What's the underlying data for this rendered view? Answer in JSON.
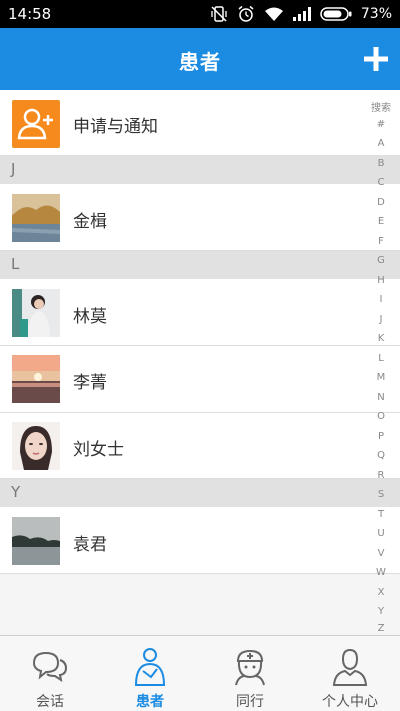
{
  "status_bar": {
    "time": "14:58",
    "battery": "73%"
  },
  "app_bar": {
    "title": "患者"
  },
  "notify_row": {
    "label": "申请与通知"
  },
  "sections": [
    {
      "letter": "J",
      "patients": [
        {
          "name": "金楫"
        }
      ]
    },
    {
      "letter": "L",
      "patients": [
        {
          "name": "林莫"
        },
        {
          "name": "李菁"
        },
        {
          "name": "刘女士"
        }
      ]
    },
    {
      "letter": "Y",
      "patients": [
        {
          "name": "袁君"
        }
      ]
    }
  ],
  "index_bar": [
    "搜索",
    "#",
    "A",
    "B",
    "C",
    "D",
    "E",
    "F",
    "G",
    "H",
    "I",
    "J",
    "K",
    "L",
    "M",
    "N",
    "O",
    "P",
    "Q",
    "R",
    "S",
    "T",
    "U",
    "V",
    "W",
    "X",
    "Y",
    "Z"
  ],
  "tabs": [
    {
      "label": "会话",
      "icon": "chat-bubbles-icon",
      "active": false
    },
    {
      "label": "患者",
      "icon": "patient-icon",
      "active": true
    },
    {
      "label": "同行",
      "icon": "nurse-icon",
      "active": false
    },
    {
      "label": "个人中心",
      "icon": "person-icon",
      "active": false
    }
  ],
  "colors": {
    "accent": "#1c8ce3",
    "notify": "#f78a1d",
    "section_bg": "#e1e1e1"
  }
}
